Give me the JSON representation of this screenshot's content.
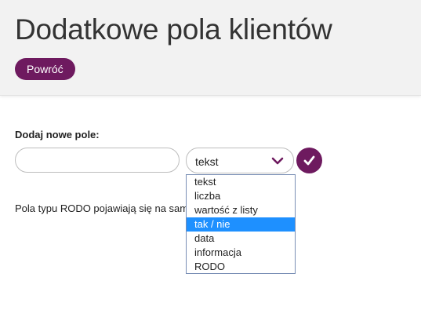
{
  "header": {
    "title": "Dodatkowe pola klientów",
    "back_label": "Powróć"
  },
  "form": {
    "section_label": "Dodaj nowe pole:",
    "name_input": {
      "value": "",
      "placeholder": ""
    },
    "type_select": {
      "selected": "tekst",
      "options": [
        "tekst",
        "liczba",
        "wartość z listy",
        "tak / nie",
        "data",
        "informacja",
        "RODO"
      ],
      "highlighted": "tak / nie"
    },
    "confirm_icon": "check-icon"
  },
  "info_text": "Pola typu RODO pojawiają się na samym dole formularza",
  "colors": {
    "accent": "#6e1a5f",
    "header_bg": "#f2f2f2",
    "highlight": "#1e90ff",
    "dropdown_border": "#7a8fb5"
  }
}
